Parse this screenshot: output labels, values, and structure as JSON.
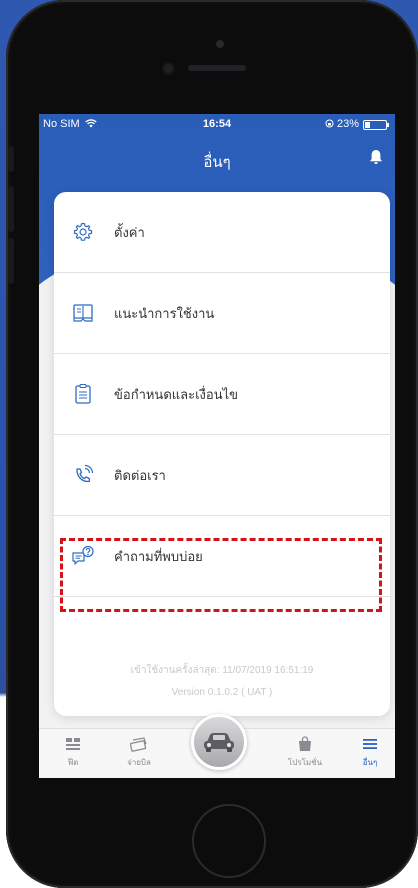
{
  "status_bar": {
    "carrier": "No SIM",
    "time": "16:54",
    "battery": "23%",
    "battery_level": 0.23
  },
  "header": {
    "title": "อื่นๆ",
    "bell_icon": "bell-icon"
  },
  "menu": {
    "items": [
      {
        "label": "ตั้งค่า",
        "icon": "gear-icon"
      },
      {
        "label": "แนะนำการใช้งาน",
        "icon": "book-icon"
      },
      {
        "label": "ข้อกำหนดและเงื่อนไข",
        "icon": "clipboard-icon"
      },
      {
        "label": "ติดต่อเรา",
        "icon": "phone-icon"
      },
      {
        "label": "คำถามที่พบบ่อย",
        "icon": "faq-chat-icon"
      }
    ]
  },
  "footer": {
    "last_login": "เข้าใช้งานครั้งล่าสุด: 11/07/2019 16:51:19",
    "version": "Version 0.1.0.2 ( UAT )"
  },
  "tabbar": {
    "tabs": [
      {
        "label": "ฟีด",
        "icon": "feed-icon",
        "active": false
      },
      {
        "label": "จ่ายบิล",
        "icon": "pay-bill-icon",
        "active": false
      },
      {
        "label": "",
        "icon": "car-icon",
        "active": false
      },
      {
        "label": "โปรโมชั่น",
        "icon": "shopping-bag-icon",
        "active": false
      },
      {
        "label": "อื่นๆ",
        "icon": "menu-icon",
        "active": true
      }
    ]
  },
  "colors": {
    "header_blue": "#2e62bd",
    "accent_blue": "#2a62c6",
    "highlight_red": "#d0141a"
  }
}
